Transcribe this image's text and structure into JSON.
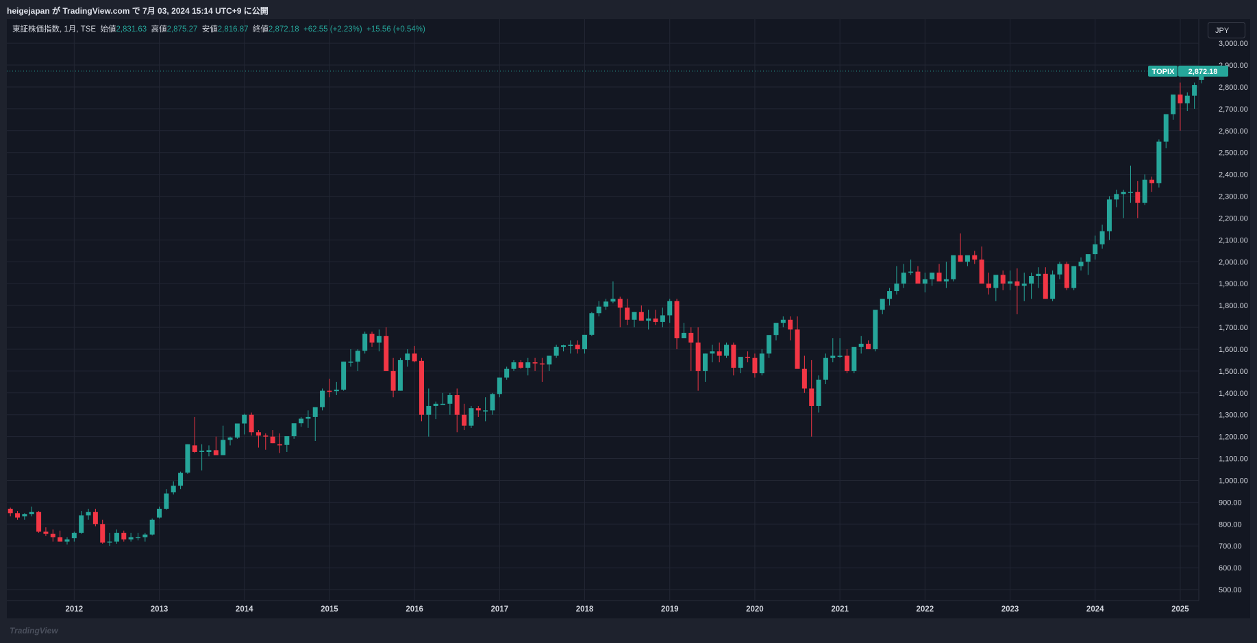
{
  "header": {
    "publish_line": "heigejapan が TradingView.com で 7月 03, 2024 15:14 UTC+9 に公開"
  },
  "legend": {
    "symbol": "東証株価指数, 1月, TSE",
    "open_label": "始値",
    "open_value": "2,831.63",
    "high_label": "高値",
    "high_value": "2,875.27",
    "low_label": "安値",
    "low_value": "2,816.87",
    "close_label": "終値",
    "close_value": "2,872.18",
    "change": "+62.55 (+2.23%)",
    "change2": "+15.56 (+0.54%)"
  },
  "currency_button": "JPY",
  "price_tag": {
    "label": "TOPIX",
    "value": "2,872.18"
  },
  "footer": {
    "logo_text": "TradingView"
  },
  "colors": {
    "up": "#26a69a",
    "down": "#f23645",
    "background": "#131722",
    "grid": "#232734",
    "text": "#d1d4dc"
  },
  "chart_data": {
    "type": "candlestick",
    "interval": "1M",
    "title": "",
    "x_ticks": [
      "2012",
      "2013",
      "2014",
      "2015",
      "2016",
      "2017",
      "2018",
      "2019",
      "2020",
      "2021",
      "2022",
      "2023",
      "2024",
      "2025"
    ],
    "y_ticks": [
      "500.00",
      "600.00",
      "700.00",
      "800.00",
      "900.00",
      "1,000.00",
      "1,100.00",
      "1,200.00",
      "1,300.00",
      "1,400.00",
      "1,500.00",
      "1,600.00",
      "1,700.00",
      "1,800.00",
      "1,900.00",
      "2,000.00",
      "2,100.00",
      "2,200.00",
      "2,300.00",
      "2,400.00",
      "2,500.00",
      "2,600.00",
      "2,700.00",
      "2,800.00",
      "2,900.00",
      "3,000.00"
    ],
    "ylim": [
      450,
      3110
    ],
    "grid": true,
    "last_close": 2872.18,
    "start": "2011-04",
    "ohlc": [
      [
        870,
        875,
        835,
        850
      ],
      [
        850,
        860,
        820,
        830
      ],
      [
        835,
        850,
        820,
        845
      ],
      [
        845,
        880,
        835,
        855
      ],
      [
        855,
        860,
        760,
        765
      ],
      [
        765,
        785,
        745,
        755
      ],
      [
        755,
        775,
        720,
        740
      ],
      [
        740,
        770,
        720,
        720
      ],
      [
        720,
        740,
        706,
        730
      ],
      [
        735,
        765,
        720,
        760
      ],
      [
        760,
        860,
        755,
        840
      ],
      [
        840,
        870,
        820,
        855
      ],
      [
        855,
        870,
        790,
        800
      ],
      [
        800,
        820,
        710,
        715
      ],
      [
        715,
        760,
        700,
        720
      ],
      [
        720,
        775,
        710,
        760
      ],
      [
        760,
        770,
        720,
        730
      ],
      [
        730,
        760,
        720,
        740
      ],
      [
        740,
        760,
        725,
        740
      ],
      [
        740,
        760,
        720,
        752
      ],
      [
        752,
        825,
        748,
        820
      ],
      [
        830,
        880,
        825,
        870
      ],
      [
        870,
        960,
        865,
        940
      ],
      [
        945,
        995,
        935,
        975
      ],
      [
        975,
        1040,
        960,
        1034
      ],
      [
        1035,
        1165,
        1030,
        1165
      ],
      [
        1160,
        1290,
        1125,
        1130
      ],
      [
        1130,
        1165,
        1045,
        1135
      ],
      [
        1130,
        1160,
        1110,
        1138
      ],
      [
        1138,
        1200,
        1120,
        1115
      ],
      [
        1115,
        1250,
        1120,
        1185
      ],
      [
        1185,
        1200,
        1160,
        1196
      ],
      [
        1196,
        1250,
        1190,
        1260
      ],
      [
        1260,
        1305,
        1210,
        1300
      ],
      [
        1300,
        1310,
        1205,
        1220
      ],
      [
        1220,
        1230,
        1150,
        1205
      ],
      [
        1205,
        1215,
        1140,
        1200
      ],
      [
        1200,
        1230,
        1170,
        1170
      ],
      [
        1165,
        1215,
        1125,
        1160
      ],
      [
        1162,
        1200,
        1130,
        1202
      ],
      [
        1202,
        1260,
        1190,
        1261
      ],
      [
        1261,
        1290,
        1245,
        1282
      ],
      [
        1282,
        1320,
        1240,
        1290
      ],
      [
        1290,
        1330,
        1180,
        1335
      ],
      [
        1335,
        1420,
        1320,
        1410
      ],
      [
        1410,
        1465,
        1380,
        1408
      ],
      [
        1408,
        1450,
        1390,
        1415
      ],
      [
        1415,
        1543,
        1410,
        1543
      ],
      [
        1543,
        1600,
        1520,
        1543
      ],
      [
        1543,
        1600,
        1500,
        1593
      ],
      [
        1593,
        1680,
        1580,
        1670
      ],
      [
        1670,
        1680,
        1610,
        1630
      ],
      [
        1630,
        1690,
        1590,
        1660
      ],
      [
        1660,
        1700,
        1500,
        1500
      ],
      [
        1500,
        1560,
        1380,
        1410
      ],
      [
        1410,
        1560,
        1410,
        1550
      ],
      [
        1550,
        1600,
        1520,
        1580
      ],
      [
        1580,
        1615,
        1540,
        1545
      ],
      [
        1547,
        1560,
        1270,
        1300
      ],
      [
        1300,
        1420,
        1200,
        1340
      ],
      [
        1340,
        1360,
        1280,
        1350
      ],
      [
        1350,
        1400,
        1350,
        1350
      ],
      [
        1350,
        1400,
        1300,
        1390
      ],
      [
        1390,
        1420,
        1220,
        1300
      ],
      [
        1300,
        1350,
        1230,
        1250
      ],
      [
        1250,
        1340,
        1240,
        1330
      ],
      [
        1330,
        1340,
        1290,
        1320
      ],
      [
        1320,
        1380,
        1270,
        1320
      ],
      [
        1320,
        1400,
        1300,
        1395
      ],
      [
        1395,
        1470,
        1380,
        1470
      ],
      [
        1470,
        1520,
        1460,
        1510
      ],
      [
        1510,
        1550,
        1500,
        1540
      ],
      [
        1540,
        1550,
        1510,
        1515
      ],
      [
        1515,
        1560,
        1480,
        1540
      ],
      [
        1540,
        1560,
        1500,
        1535
      ],
      [
        1535,
        1560,
        1450,
        1530
      ],
      [
        1530,
        1570,
        1500,
        1570
      ],
      [
        1570,
        1620,
        1560,
        1610
      ],
      [
        1610,
        1620,
        1590,
        1618
      ],
      [
        1618,
        1640,
        1580,
        1620
      ],
      [
        1620,
        1640,
        1580,
        1600
      ],
      [
        1600,
        1660,
        1580,
        1666
      ],
      [
        1666,
        1770,
        1660,
        1765
      ],
      [
        1765,
        1820,
        1750,
        1795
      ],
      [
        1795,
        1830,
        1780,
        1818
      ],
      [
        1818,
        1910,
        1810,
        1830
      ],
      [
        1830,
        1840,
        1700,
        1790
      ],
      [
        1790,
        1830,
        1710,
        1735
      ],
      [
        1735,
        1770,
        1700,
        1770
      ],
      [
        1770,
        1800,
        1740,
        1730
      ],
      [
        1730,
        1780,
        1690,
        1740
      ],
      [
        1740,
        1780,
        1710,
        1725
      ],
      [
        1725,
        1790,
        1700,
        1755
      ],
      [
        1755,
        1830,
        1720,
        1820
      ],
      [
        1820,
        1830,
        1600,
        1650
      ],
      [
        1650,
        1720,
        1650,
        1675
      ],
      [
        1675,
        1700,
        1500,
        1630
      ],
      [
        1630,
        1700,
        1410,
        1500
      ],
      [
        1500,
        1580,
        1450,
        1580
      ],
      [
        1580,
        1620,
        1540,
        1590
      ],
      [
        1590,
        1630,
        1540,
        1570
      ],
      [
        1570,
        1630,
        1560,
        1620
      ],
      [
        1620,
        1630,
        1480,
        1515
      ],
      [
        1515,
        1560,
        1490,
        1565
      ],
      [
        1565,
        1590,
        1540,
        1560
      ],
      [
        1560,
        1580,
        1470,
        1490
      ],
      [
        1490,
        1600,
        1480,
        1580
      ],
      [
        1580,
        1650,
        1560,
        1665
      ],
      [
        1665,
        1710,
        1640,
        1720
      ],
      [
        1720,
        1750,
        1700,
        1735
      ],
      [
        1735,
        1750,
        1640,
        1690
      ],
      [
        1690,
        1750,
        1550,
        1510
      ],
      [
        1510,
        1570,
        1400,
        1420
      ],
      [
        1420,
        1550,
        1200,
        1340
      ],
      [
        1340,
        1480,
        1310,
        1460
      ],
      [
        1460,
        1580,
        1440,
        1560
      ],
      [
        1560,
        1650,
        1540,
        1570
      ],
      [
        1570,
        1650,
        1560,
        1570
      ],
      [
        1570,
        1600,
        1490,
        1500
      ],
      [
        1500,
        1600,
        1490,
        1610
      ],
      [
        1610,
        1660,
        1580,
        1625
      ],
      [
        1625,
        1640,
        1600,
        1600
      ],
      [
        1600,
        1780,
        1590,
        1780
      ],
      [
        1780,
        1820,
        1760,
        1830
      ],
      [
        1830,
        1880,
        1800,
        1866
      ],
      [
        1866,
        1980,
        1850,
        1900
      ],
      [
        1900,
        1990,
        1880,
        1950
      ],
      [
        1950,
        2010,
        1940,
        1955
      ],
      [
        1955,
        1980,
        1920,
        1900
      ],
      [
        1900,
        1950,
        1860,
        1920
      ],
      [
        1920,
        1950,
        1890,
        1950
      ],
      [
        1950,
        1990,
        1920,
        1910
      ],
      [
        1910,
        2000,
        1880,
        1920
      ],
      [
        1920,
        2020,
        1910,
        2030
      ],
      [
        2030,
        2130,
        2000,
        2000
      ],
      [
        2000,
        2020,
        1980,
        2030
      ],
      [
        2030,
        2050,
        1990,
        2010
      ],
      [
        2010,
        2070,
        1960,
        1900
      ],
      [
        1900,
        1950,
        1850,
        1880
      ],
      [
        1880,
        1930,
        1820,
        1940
      ],
      [
        1940,
        1960,
        1870,
        1900
      ],
      [
        1900,
        1960,
        1870,
        1910
      ],
      [
        1910,
        1970,
        1760,
        1890
      ],
      [
        1890,
        1950,
        1820,
        1900
      ],
      [
        1900,
        1950,
        1830,
        1935
      ],
      [
        1935,
        1975,
        1880,
        1945
      ],
      [
        1945,
        1975,
        1830,
        1830
      ],
      [
        1830,
        1960,
        1820,
        1942
      ],
      [
        1942,
        2000,
        1920,
        1990
      ],
      [
        1990,
        2000,
        1870,
        1880
      ],
      [
        1880,
        1980,
        1870,
        1980
      ],
      [
        1980,
        2020,
        1960,
        2000
      ],
      [
        2000,
        2025,
        1940,
        2035
      ],
      [
        2035,
        2120,
        2010,
        2080
      ],
      [
        2080,
        2170,
        2060,
        2140
      ],
      [
        2140,
        2300,
        2100,
        2285
      ],
      [
        2285,
        2330,
        2250,
        2310
      ],
      [
        2310,
        2330,
        2200,
        2320
      ],
      [
        2320,
        2440,
        2270,
        2320
      ],
      [
        2320,
        2370,
        2200,
        2270
      ],
      [
        2270,
        2400,
        2260,
        2375
      ],
      [
        2375,
        2390,
        2320,
        2360
      ],
      [
        2360,
        2560,
        2340,
        2550
      ],
      [
        2550,
        2650,
        2520,
        2675
      ],
      [
        2675,
        2760,
        2650,
        2765
      ],
      [
        2765,
        2820,
        2600,
        2725
      ],
      [
        2725,
        2775,
        2690,
        2760
      ],
      [
        2760,
        2820,
        2700,
        2809
      ],
      [
        2831.63,
        2875.27,
        2816.87,
        2872.18
      ]
    ]
  }
}
